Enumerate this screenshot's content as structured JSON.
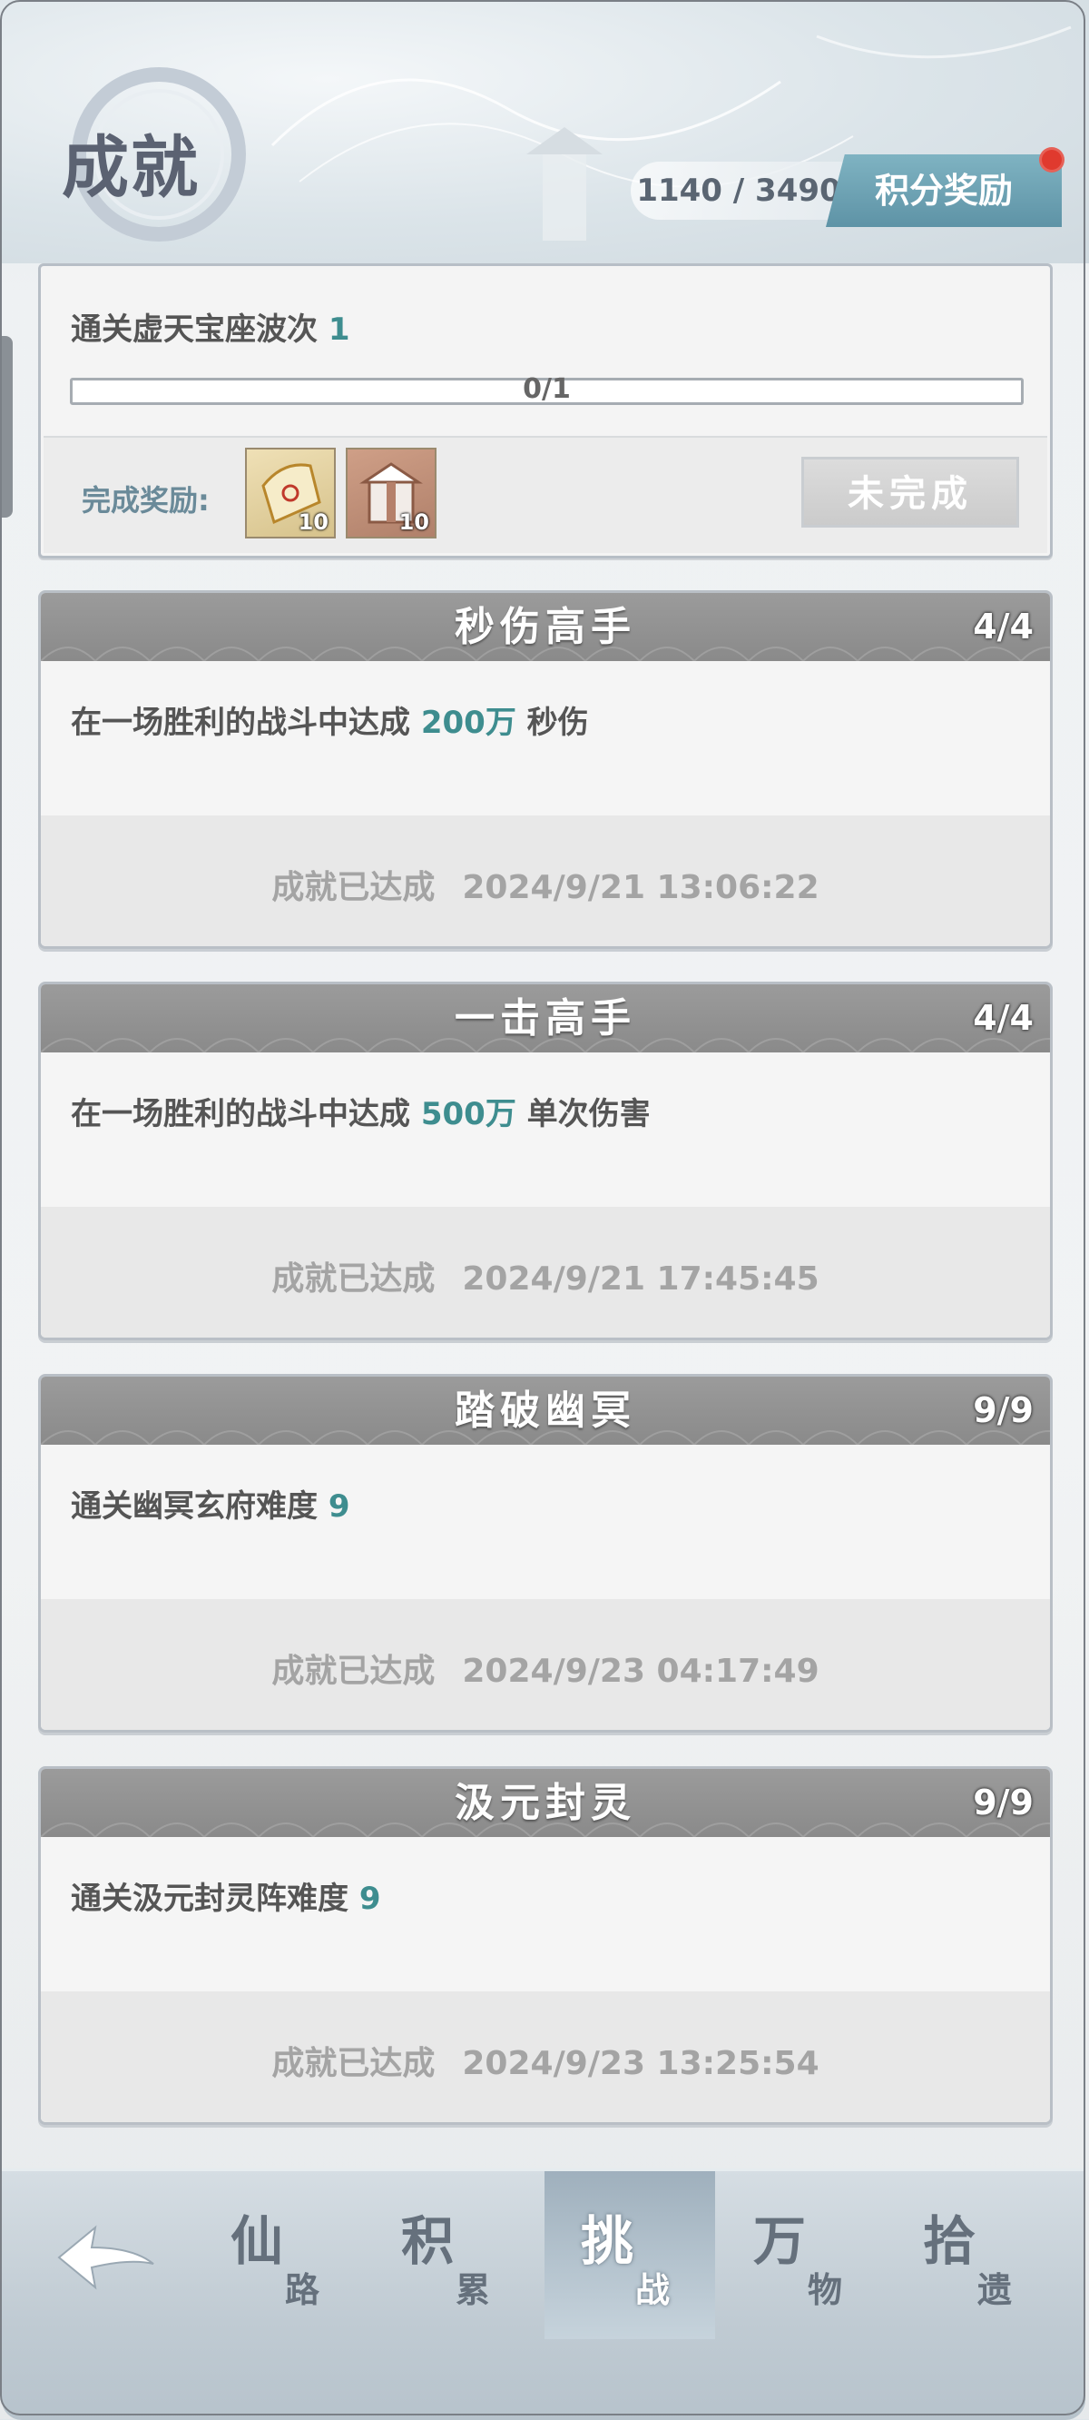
{
  "header": {
    "title": "成就",
    "score_current": "1140",
    "score_separator": " / ",
    "score_total": "3490",
    "reward_button": "积分奖励"
  },
  "top_card": {
    "desc_prefix": "通关虚天宝座波次 ",
    "desc_value": "1",
    "progress_text": "0/1",
    "progress_fraction": 0,
    "reward_label": "完成奖励:",
    "rewards": [
      {
        "icon": "fan-token-icon",
        "count": "10"
      },
      {
        "icon": "gift-box-icon",
        "count": "10"
      }
    ],
    "status": "未完成"
  },
  "achievements": [
    {
      "title": "秒伤高手",
      "count": "4/4",
      "desc_prefix": "在一场胜利的战斗中达成 ",
      "desc_value": "200万",
      "desc_suffix": " 秒伤",
      "status": "成就已达成",
      "time": "2024/9/21 13:06:22"
    },
    {
      "title": "一击高手",
      "count": "4/4",
      "desc_prefix": "在一场胜利的战斗中达成 ",
      "desc_value": "500万",
      "desc_suffix": " 单次伤害",
      "status": "成就已达成",
      "time": "2024/9/21 17:45:45"
    },
    {
      "title": "踏破幽冥",
      "count": "9/9",
      "desc_prefix": "通关幽冥玄府难度 ",
      "desc_value": "9",
      "desc_suffix": "",
      "status": "成就已达成",
      "time": "2024/9/23 04:17:49"
    },
    {
      "title": "汲元封灵",
      "count": "9/9",
      "desc_prefix": "通关汲元封灵阵难度 ",
      "desc_value": "9",
      "desc_suffix": "",
      "status": "成就已达成",
      "time": "2024/9/23 13:25:54"
    }
  ],
  "nav": {
    "back_icon": "back-arrow-icon",
    "tabs": [
      {
        "main": "仙",
        "sub": "路"
      },
      {
        "main": "积",
        "sub": "累"
      },
      {
        "main": "挑",
        "sub": "战",
        "active": true
      },
      {
        "main": "万",
        "sub": "物"
      },
      {
        "main": "拾",
        "sub": "遗"
      }
    ]
  },
  "colors": {
    "accent": "#3e8d8f",
    "reward_button": "#6aa0b2",
    "notify_dot": "#e03a2e",
    "card_header": "#8e8e8e"
  }
}
